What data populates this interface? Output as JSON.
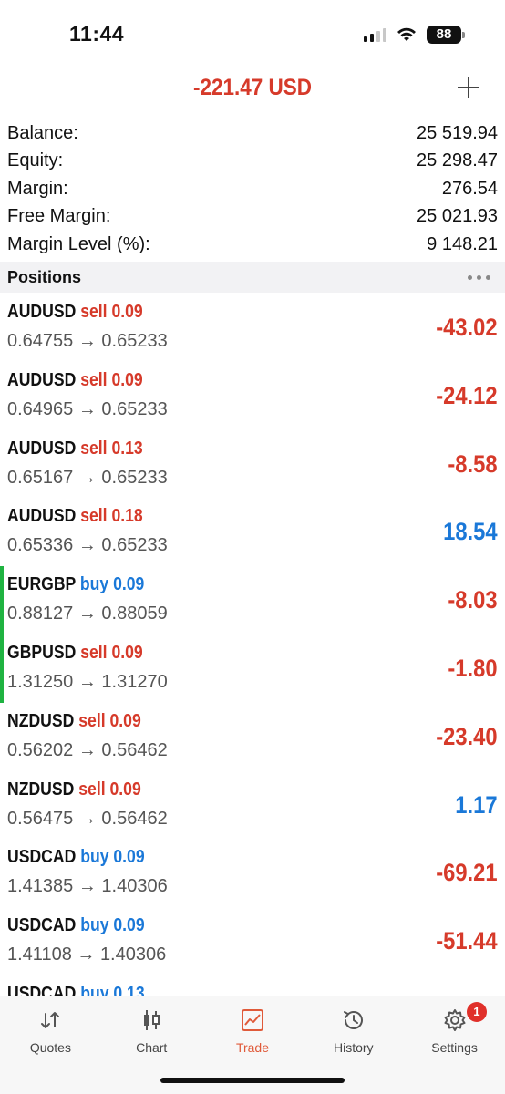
{
  "status_bar": {
    "time": "11:44",
    "battery": "88"
  },
  "header": {
    "total_profit": "-221.47 USD"
  },
  "summary": [
    {
      "label": "Balance:",
      "value": "25 519.94"
    },
    {
      "label": "Equity:",
      "value": "25 298.47"
    },
    {
      "label": "Margin:",
      "value": "276.54"
    },
    {
      "label": "Free Margin:",
      "value": "25 021.93"
    },
    {
      "label": "Margin Level (%):",
      "value": "9 148.21"
    }
  ],
  "positions_title": "Positions",
  "positions": [
    {
      "symbol": "AUDUSD",
      "side": "sell",
      "volume": "0.09",
      "open": "0.64755",
      "current": "0.65233",
      "profit": "-43.02",
      "marked": false
    },
    {
      "symbol": "AUDUSD",
      "side": "sell",
      "volume": "0.09",
      "open": "0.64965",
      "current": "0.65233",
      "profit": "-24.12",
      "marked": false
    },
    {
      "symbol": "AUDUSD",
      "side": "sell",
      "volume": "0.13",
      "open": "0.65167",
      "current": "0.65233",
      "profit": "-8.58",
      "marked": false
    },
    {
      "symbol": "AUDUSD",
      "side": "sell",
      "volume": "0.18",
      "open": "0.65336",
      "current": "0.65233",
      "profit": "18.54",
      "marked": false
    },
    {
      "symbol": "EURGBP",
      "side": "buy",
      "volume": "0.09",
      "open": "0.88127",
      "current": "0.88059",
      "profit": "-8.03",
      "marked": true
    },
    {
      "symbol": "GBPUSD",
      "side": "sell",
      "volume": "0.09",
      "open": "1.31250",
      "current": "1.31270",
      "profit": "-1.80",
      "marked": true
    },
    {
      "symbol": "NZDUSD",
      "side": "sell",
      "volume": "0.09",
      "open": "0.56202",
      "current": "0.56462",
      "profit": "-23.40",
      "marked": false
    },
    {
      "symbol": "NZDUSD",
      "side": "sell",
      "volume": "0.09",
      "open": "0.56475",
      "current": "0.56462",
      "profit": "1.17",
      "marked": false
    },
    {
      "symbol": "USDCAD",
      "side": "buy",
      "volume": "0.09",
      "open": "1.41385",
      "current": "1.40306",
      "profit": "-69.21",
      "marked": false
    },
    {
      "symbol": "USDCAD",
      "side": "buy",
      "volume": "0.09",
      "open": "1.41108",
      "current": "1.40306",
      "profit": "-51.44",
      "marked": false
    },
    {
      "symbol": "USDCAD",
      "side": "buy",
      "volume": "0.13",
      "open": "",
      "current": "",
      "profit": "",
      "marked": false
    }
  ],
  "colors": {
    "loss": "#d63a2a",
    "gain": "#1a78d8",
    "marker": "#1fb341",
    "active_tab": "#e05a3a"
  },
  "tabs": [
    {
      "label": "Quotes",
      "icon": "quotes-arrows-icon",
      "active": false
    },
    {
      "label": "Chart",
      "icon": "candlestick-icon",
      "active": false
    },
    {
      "label": "Trade",
      "icon": "trade-chart-icon",
      "active": true
    },
    {
      "label": "History",
      "icon": "history-clock-icon",
      "active": false
    },
    {
      "label": "Settings",
      "icon": "gear-icon",
      "active": false,
      "badge": "1"
    }
  ]
}
